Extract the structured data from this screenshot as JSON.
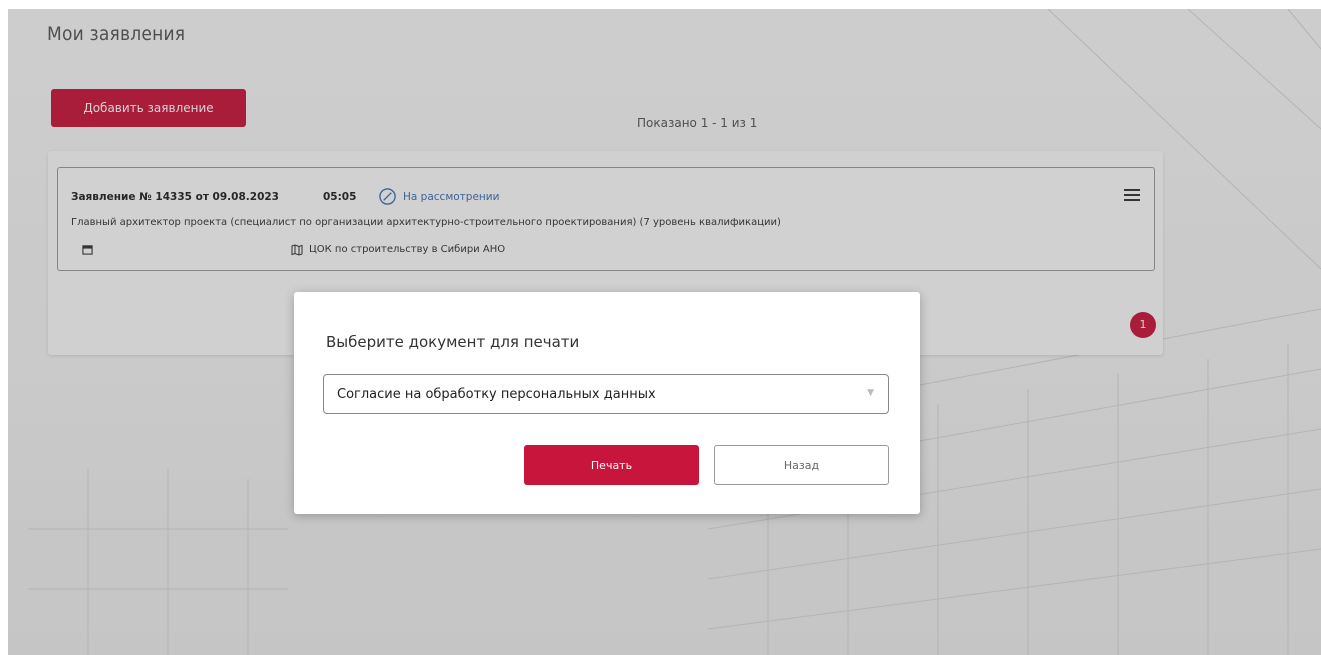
{
  "page": {
    "title": "Мои заявления",
    "add_button_label": "Добавить заявление",
    "shown_text": "Показано 1 - 1 из 1"
  },
  "application": {
    "title": "Заявление № 14335 от 09.08.2023",
    "time": "05:05",
    "status": "На рассмотрении",
    "description": "Главный архитектор проекта (специалист по организации архитектурно-строительного проектирования) (7 уровень квалификации)",
    "organization": "ЦОК по строительству в Сибири АНО",
    "status_icon": "check-circle-icon",
    "menu_icon": "hamburger-menu-icon",
    "date_icon": "calendar-icon",
    "org_icon": "map-icon"
  },
  "pagination": {
    "current_page": "1"
  },
  "modal": {
    "title": "Выберите документ для печати",
    "selected_document": "Согласие на обработку персональных данных",
    "print_label": "Печать",
    "back_label": "Назад"
  },
  "colors": {
    "accent": "#c8153c",
    "status_blue": "#3a6fb0"
  }
}
